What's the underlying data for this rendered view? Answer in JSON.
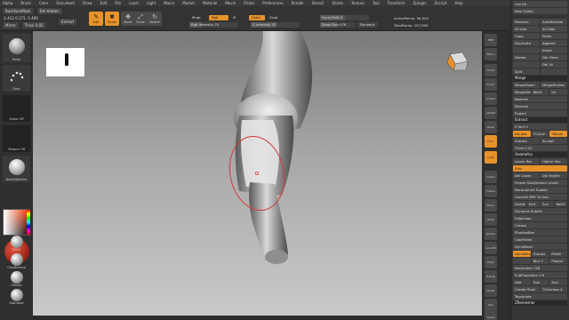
{
  "menu": [
    "Alpha",
    "Brush",
    "Color",
    "Document",
    "Draw",
    "Edit",
    "File",
    "Layer",
    "Light",
    "Macro",
    "Marker",
    "Material",
    "Movie",
    "Picker",
    "Preferences",
    "Render",
    "Stencil",
    "Stroke",
    "Texture",
    "Tool",
    "Transform",
    "Zplugin",
    "Zscript",
    "Help"
  ],
  "topbar": {
    "home": "BackfaceMask",
    "del_hidden": "Del Hidden",
    "extract": "Extract",
    "coords": "-1.412 0.171 -1.469",
    "mirror": "Mirror",
    "thick_label": "Thick",
    "thick_value": "0.02",
    "edit": "Edit",
    "draw": "Draw",
    "move": "Move",
    "scale": "Scale",
    "rotate": "Rotate",
    "mrgb": "Mrgb",
    "rgb": "Rgb",
    "m": "M",
    "rgb_intensity": "Rgb Intensity 25",
    "zadd": "Zadd",
    "zsub": "Zsub",
    "zintensity": "Z Intensity 53",
    "focal_shift": "Focal Shift 0",
    "draw_size": "Draw Size 476",
    "dynamic": "Dynamic",
    "active_points": "ActivePoints: 56,904",
    "total_points": "TotalPoints: 197,993"
  },
  "leftshelf": {
    "brush": "Move",
    "stroke": "Dots",
    "alpha": "Alpha Off",
    "texture": "Texture Off",
    "material": "BasicMaterial",
    "small_tools": [
      "Pinch",
      "ClayBuildup",
      "hPolish",
      "Standard"
    ]
  },
  "rightshelf": [
    "BPR",
    "SPix 3",
    "Scroll",
    "Zoom",
    "Actual",
    "AAHalf",
    "Persp",
    "Floor",
    "Local",
    "Gizmo",
    "Frame",
    "Move",
    "Scale",
    "Rotate",
    "Line Fill",
    "PolyF",
    "Transp",
    "Ghost",
    "Solo",
    "Xpose"
  ],
  "panel": {
    "top": [
      "Lite Kit",
      "New Folder"
    ],
    "subtool_ops": [
      [
        "Rename",
        "AutoReorder"
      ],
      [
        "All Low",
        "All High"
      ],
      [
        "Copy",
        "Paste"
      ],
      [
        "Duplicate",
        "Append"
      ],
      [
        "",
        "Insert"
      ],
      [
        "Delete",
        "Del Other"
      ],
      [
        "",
        "Del All"
      ],
      [
        "Split",
        ""
      ]
    ],
    "merge_header": "Merge",
    "merge_rows": [
      [
        "MergeDown",
        "MergeSimilar"
      ],
      [
        "MergeVisible",
        "Weld",
        "Uv"
      ],
      [
        "Boolean"
      ],
      [
        "Remesh"
      ],
      [
        "Project"
      ]
    ],
    "extract_header": "Extract",
    "extract_rows": [
      [
        "S Smt 5"
      ],
      [
        "Double",
        "TCorne",
        "TBordr"
      ],
      [
        "Extract",
        "Accept"
      ],
      [
        "Thick 0.02"
      ]
    ],
    "geometry_header": "Geometry",
    "geometry_rows": [
      [
        "Lower Res",
        "Higher Res"
      ],
      [
        "Sdiv"
      ],
      [
        "Del Lower",
        "Del Higher"
      ],
      [
        "Freeze SubDivision Levels"
      ],
      [
        "Reconstruct Subdiv"
      ],
      [
        "Convert BPR To Geo"
      ],
      [
        "Divide",
        "Smt",
        "Suv",
        "ReUV"
      ],
      [
        "Dynamic Subdiv"
      ],
      [
        "EdgeLoop"
      ],
      [
        "Crease"
      ],
      [
        "ShadowBox"
      ],
      [
        "ClayPolish"
      ],
      [
        "DynaMesh"
      ]
    ],
    "dynamesh_rows": [
      [
        "DynaMesh",
        "Groups",
        "Polish"
      ],
      [
        "",
        "Blur 2",
        "Project"
      ],
      [
        "Resolution 128"
      ],
      [
        "SubProjection 0.6"
      ],
      [
        "Add",
        "Sub",
        "And"
      ],
      [
        "Create Shell",
        "Thickness 4"
      ],
      [
        "Tessimate"
      ]
    ],
    "zremesher_header": "ZRemesher"
  },
  "colors": {
    "accent": "#e8922a",
    "panel": "#353535"
  }
}
